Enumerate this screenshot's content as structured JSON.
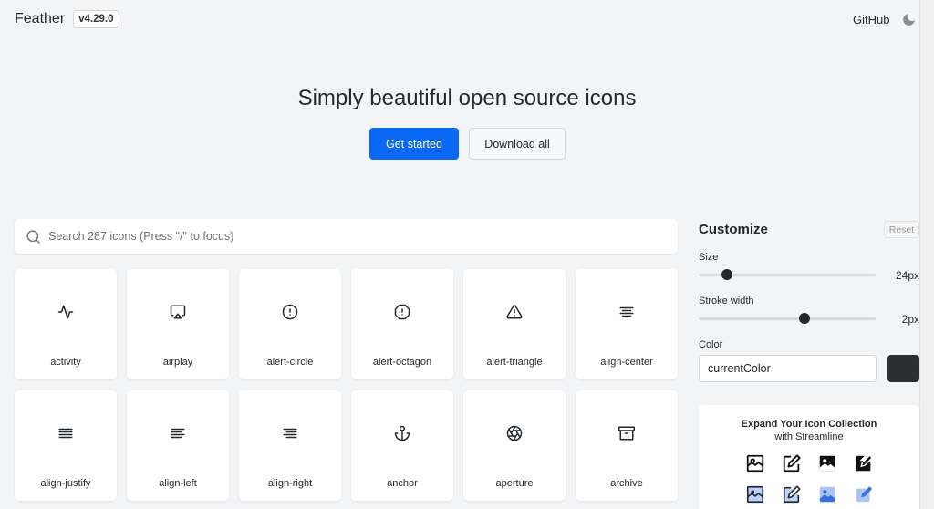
{
  "header": {
    "brand": "Feather",
    "version": "v4.29.0",
    "github": "GitHub"
  },
  "hero": {
    "title": "Simply beautiful open source icons",
    "primary_button": "Get started",
    "secondary_button": "Download all"
  },
  "search": {
    "placeholder": "Search 287 icons (Press \"/\" to focus)"
  },
  "icons": [
    {
      "name": "activity",
      "icon": "activity-icon"
    },
    {
      "name": "airplay",
      "icon": "airplay-icon"
    },
    {
      "name": "alert-circle",
      "icon": "alert-circle-icon"
    },
    {
      "name": "alert-octagon",
      "icon": "alert-octagon-icon"
    },
    {
      "name": "alert-triangle",
      "icon": "alert-triangle-icon"
    },
    {
      "name": "align-center",
      "icon": "align-center-icon"
    },
    {
      "name": "align-justify",
      "icon": "align-justify-icon"
    },
    {
      "name": "align-left",
      "icon": "align-left-icon"
    },
    {
      "name": "align-right",
      "icon": "align-right-icon"
    },
    {
      "name": "anchor",
      "icon": "anchor-icon"
    },
    {
      "name": "aperture",
      "icon": "aperture-icon"
    },
    {
      "name": "archive",
      "icon": "archive-icon"
    }
  ],
  "customize": {
    "title": "Customize",
    "reset_label": "Reset",
    "size_label": "Size",
    "size_value": "24px",
    "size_fraction": 0.16,
    "stroke_label": "Stroke width",
    "stroke_value": "2px",
    "stroke_fraction": 0.6,
    "color_label": "Color",
    "color_value": "currentColor",
    "swatch_color": "#2b2f33"
  },
  "promo": {
    "title": "Expand Your Icon Collection",
    "subtitle": "with Streamline"
  },
  "colors": {
    "accent": "#0969f6",
    "text": "#24292e",
    "background": "#f3f4f6"
  }
}
